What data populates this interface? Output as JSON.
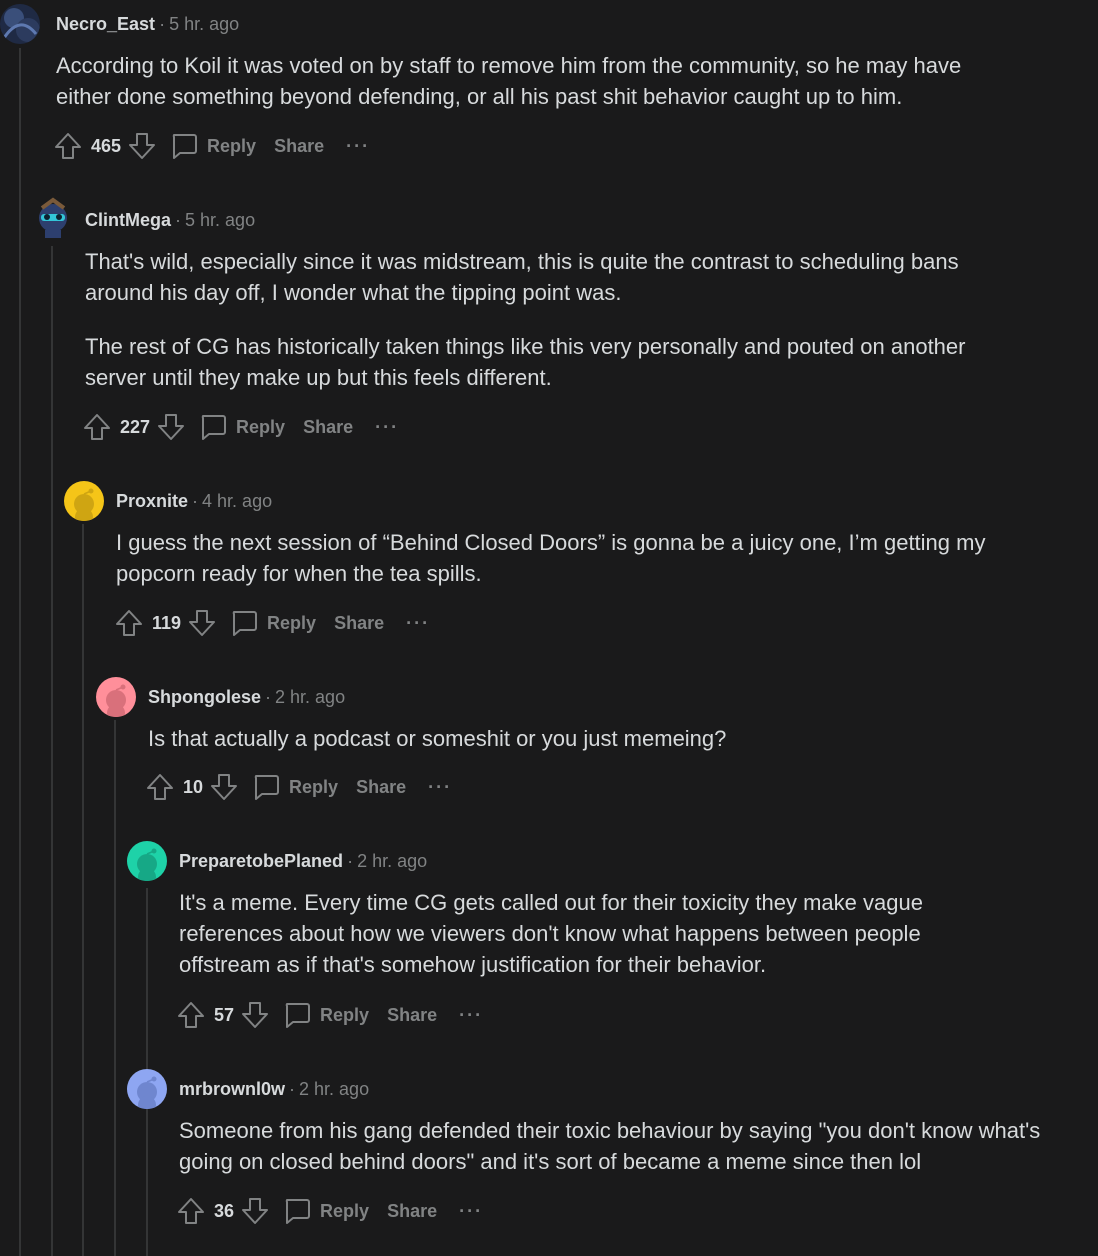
{
  "comments": [
    {
      "author": "Necro_East",
      "time": "5 hr. ago",
      "body": [
        "According to Koil it was voted on by staff to remove him from the community, so he may have either done something beyond defending, or all his past shit behavior caught up to him."
      ],
      "score": "465"
    },
    {
      "author": "ClintMega",
      "time": "5 hr. ago",
      "body": [
        "That's wild, especially since it was midstream, this is quite the contrast to scheduling bans around his day off, I wonder what the tipping point was.",
        "The rest of CG has historically taken things like this very personally and pouted on another server until they make up but this feels different."
      ],
      "score": "227"
    },
    {
      "author": "Proxnite",
      "time": "4 hr. ago",
      "body": [
        "I guess the next session of “Behind Closed Doors” is gonna be a juicy one, I’m getting my popcorn ready for when the tea spills."
      ],
      "score": "119"
    },
    {
      "author": "Shpongolese",
      "time": "2 hr. ago",
      "body": [
        "Is that actually a podcast or someshit or you just memeing?"
      ],
      "score": "10"
    },
    {
      "author": "PreparetobePlaned",
      "time": "2 hr. ago",
      "body": [
        "It's a meme. Every time CG gets called out for their toxicity they make vague references about how we viewers don't know what happens between people offstream as if that's somehow justification for their behavior."
      ],
      "score": "57"
    },
    {
      "author": "mrbrownl0w",
      "time": "2 hr. ago",
      "body": [
        "Someone from his gang defended their toxic behaviour by saying \"you don't know what's going on closed behind doors\" and it's sort of became a meme since then lol"
      ],
      "score": "36"
    }
  ],
  "actions": {
    "reply_label": "Reply",
    "share_label": "Share",
    "more_label": "···"
  },
  "header_separator": "·",
  "icons": {
    "upvote": "upvote-arrow-icon",
    "downvote": "downvote-arrow-icon",
    "reply": "comment-bubble-icon",
    "more": "more-options-icon"
  },
  "colors": {
    "background": "#1a1a1b",
    "text": "#d7dadc",
    "muted": "#818384",
    "thread_line": "#343536",
    "avatar_proxnite": "#f5c518",
    "avatar_shpongolese": "#ff8f9a",
    "avatar_preparetobeplaned": "#1ed2a8",
    "avatar_mrbrownl0w": "#8ea6f2"
  }
}
